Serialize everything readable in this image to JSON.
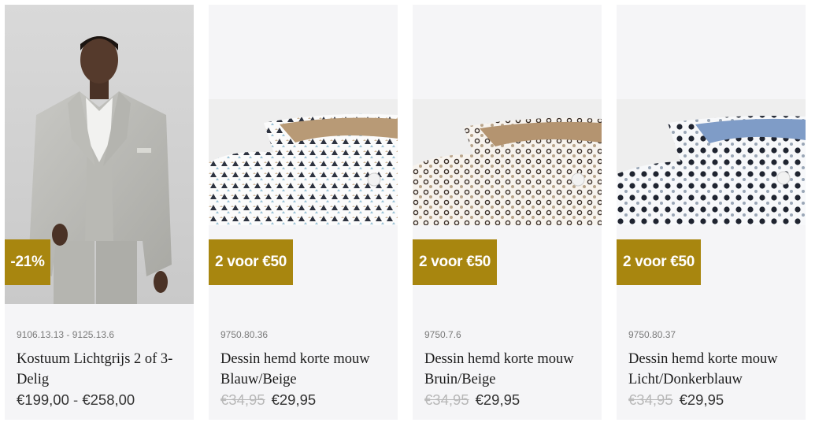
{
  "products": [
    {
      "badge": "-21%",
      "sku": "9106.13.13 - 9125.13.6",
      "title": "Kostuum Lichtgrijs 2 of 3-Delig",
      "price_from": "€199,00",
      "price_sep": " - ",
      "price_to": "€258,00"
    },
    {
      "badge": "2 voor €50",
      "sku": "9750.80.36",
      "title": "Dessin hemd korte mouw Blauw/Beige",
      "price_old": "€34,95",
      "price_new": "€29,95"
    },
    {
      "badge": "2 voor €50",
      "sku": "9750.7.6",
      "title": "Dessin hemd korte mouw Bruin/Beige",
      "price_old": "€34,95",
      "price_new": "€29,95"
    },
    {
      "badge": "2 voor €50",
      "sku": "9750.80.37",
      "title": "Dessin hemd korte mouw Licht/Donkerblauw",
      "price_old": "€34,95",
      "price_new": "€29,95"
    }
  ],
  "colors": {
    "badge": "#a8860f",
    "card": "#f5f5f7"
  },
  "icons": [
    "suit-photo",
    "shirt-collar-photo"
  ]
}
